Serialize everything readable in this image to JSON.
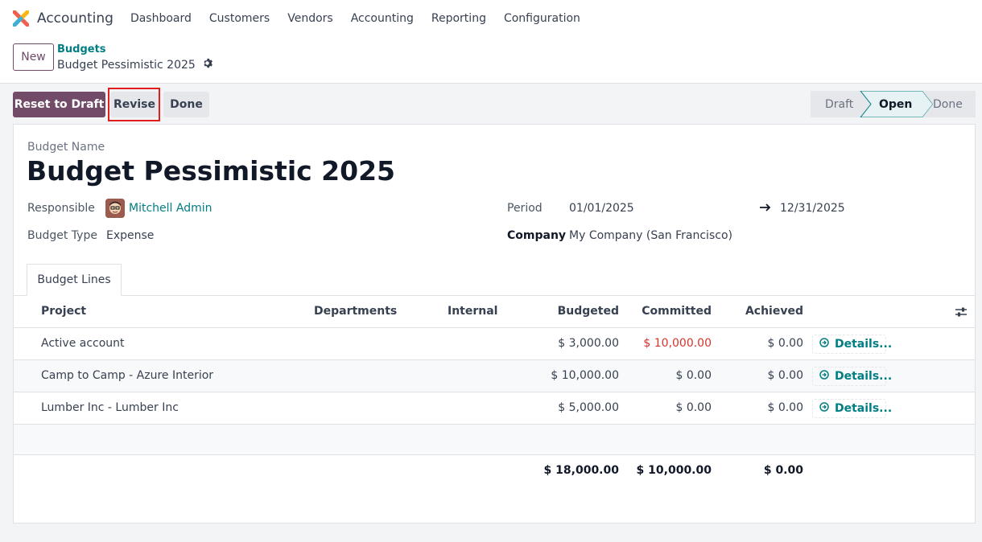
{
  "app": {
    "name": "Accounting"
  },
  "nav": {
    "items": [
      "Dashboard",
      "Customers",
      "Vendors",
      "Accounting",
      "Reporting",
      "Configuration"
    ]
  },
  "control": {
    "new_label": "New",
    "breadcrumb_parent": "Budgets",
    "breadcrumb_current": "Budget Pessimistic 2025"
  },
  "actions": {
    "reset_label": "Reset to Draft",
    "revise_label": "Revise",
    "done_label": "Done"
  },
  "stages": {
    "items": [
      "Draft",
      "Open",
      "Done"
    ],
    "active": "Open"
  },
  "form": {
    "name_label": "Budget Name",
    "name": "Budget Pessimistic 2025",
    "responsible_label": "Responsible",
    "responsible": "Mitchell Admin",
    "type_label": "Budget Type",
    "type": "Expense",
    "period_label": "Period",
    "period_start": "01/01/2025",
    "period_end": "12/31/2025",
    "company_label": "Company",
    "company": "My Company (San Francisco)"
  },
  "tabs": {
    "budget_lines": "Budget Lines"
  },
  "table": {
    "headers": {
      "project": "Project",
      "departments": "Departments",
      "internal": "Internal",
      "budgeted": "Budgeted",
      "committed": "Committed",
      "achieved": "Achieved"
    },
    "rows": [
      {
        "project": "Active account",
        "budgeted": "$ 3,000.00",
        "committed": "$ 10,000.00",
        "achieved": "$ 0.00",
        "details": "Details..."
      },
      {
        "project": "Camp to Camp - Azure Interior",
        "budgeted": "$ 10,000.00",
        "committed": "$ 0.00",
        "achieved": "$ 0.00",
        "details": "Details..."
      },
      {
        "project": "Lumber Inc - Lumber Inc",
        "budgeted": "$ 5,000.00",
        "committed": "$ 0.00",
        "achieved": "$ 0.00",
        "details": "Details..."
      }
    ],
    "totals": {
      "budgeted": "$ 18,000.00",
      "committed": "$ 10,000.00",
      "achieved": "$ 0.00"
    }
  },
  "colors": {
    "brand": "#714b67",
    "link": "#017e84",
    "warning": "#d9332b",
    "highlight": "#e11d1d"
  }
}
